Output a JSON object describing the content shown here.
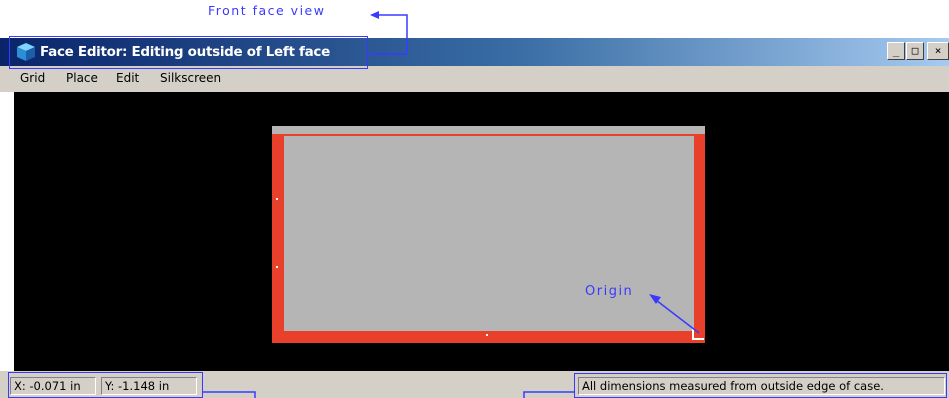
{
  "annotations": {
    "front_face_view": "Front face view",
    "origin": "Origin"
  },
  "window": {
    "title": "Face Editor: Editing outside of Left face",
    "icon": "3d-box-icon",
    "buttons": {
      "minimize": "_",
      "maximize": "□",
      "close": "×"
    }
  },
  "menu": {
    "items": [
      "Grid",
      "Place",
      "Edit",
      "Silkscreen"
    ]
  },
  "canvas": {
    "background": "#000000",
    "face_color": "#b5b5b5",
    "border_color": "#e9402c"
  },
  "status": {
    "x": "X: -0.071 in",
    "y": "Y: -1.148 in",
    "message": "All dimensions measured from outside edge of case."
  },
  "colors": {
    "annotation": "#3a3aff",
    "titlebar_start": "#0a246a",
    "titlebar_end": "#a6caf0",
    "chrome": "#d4d0c8"
  }
}
